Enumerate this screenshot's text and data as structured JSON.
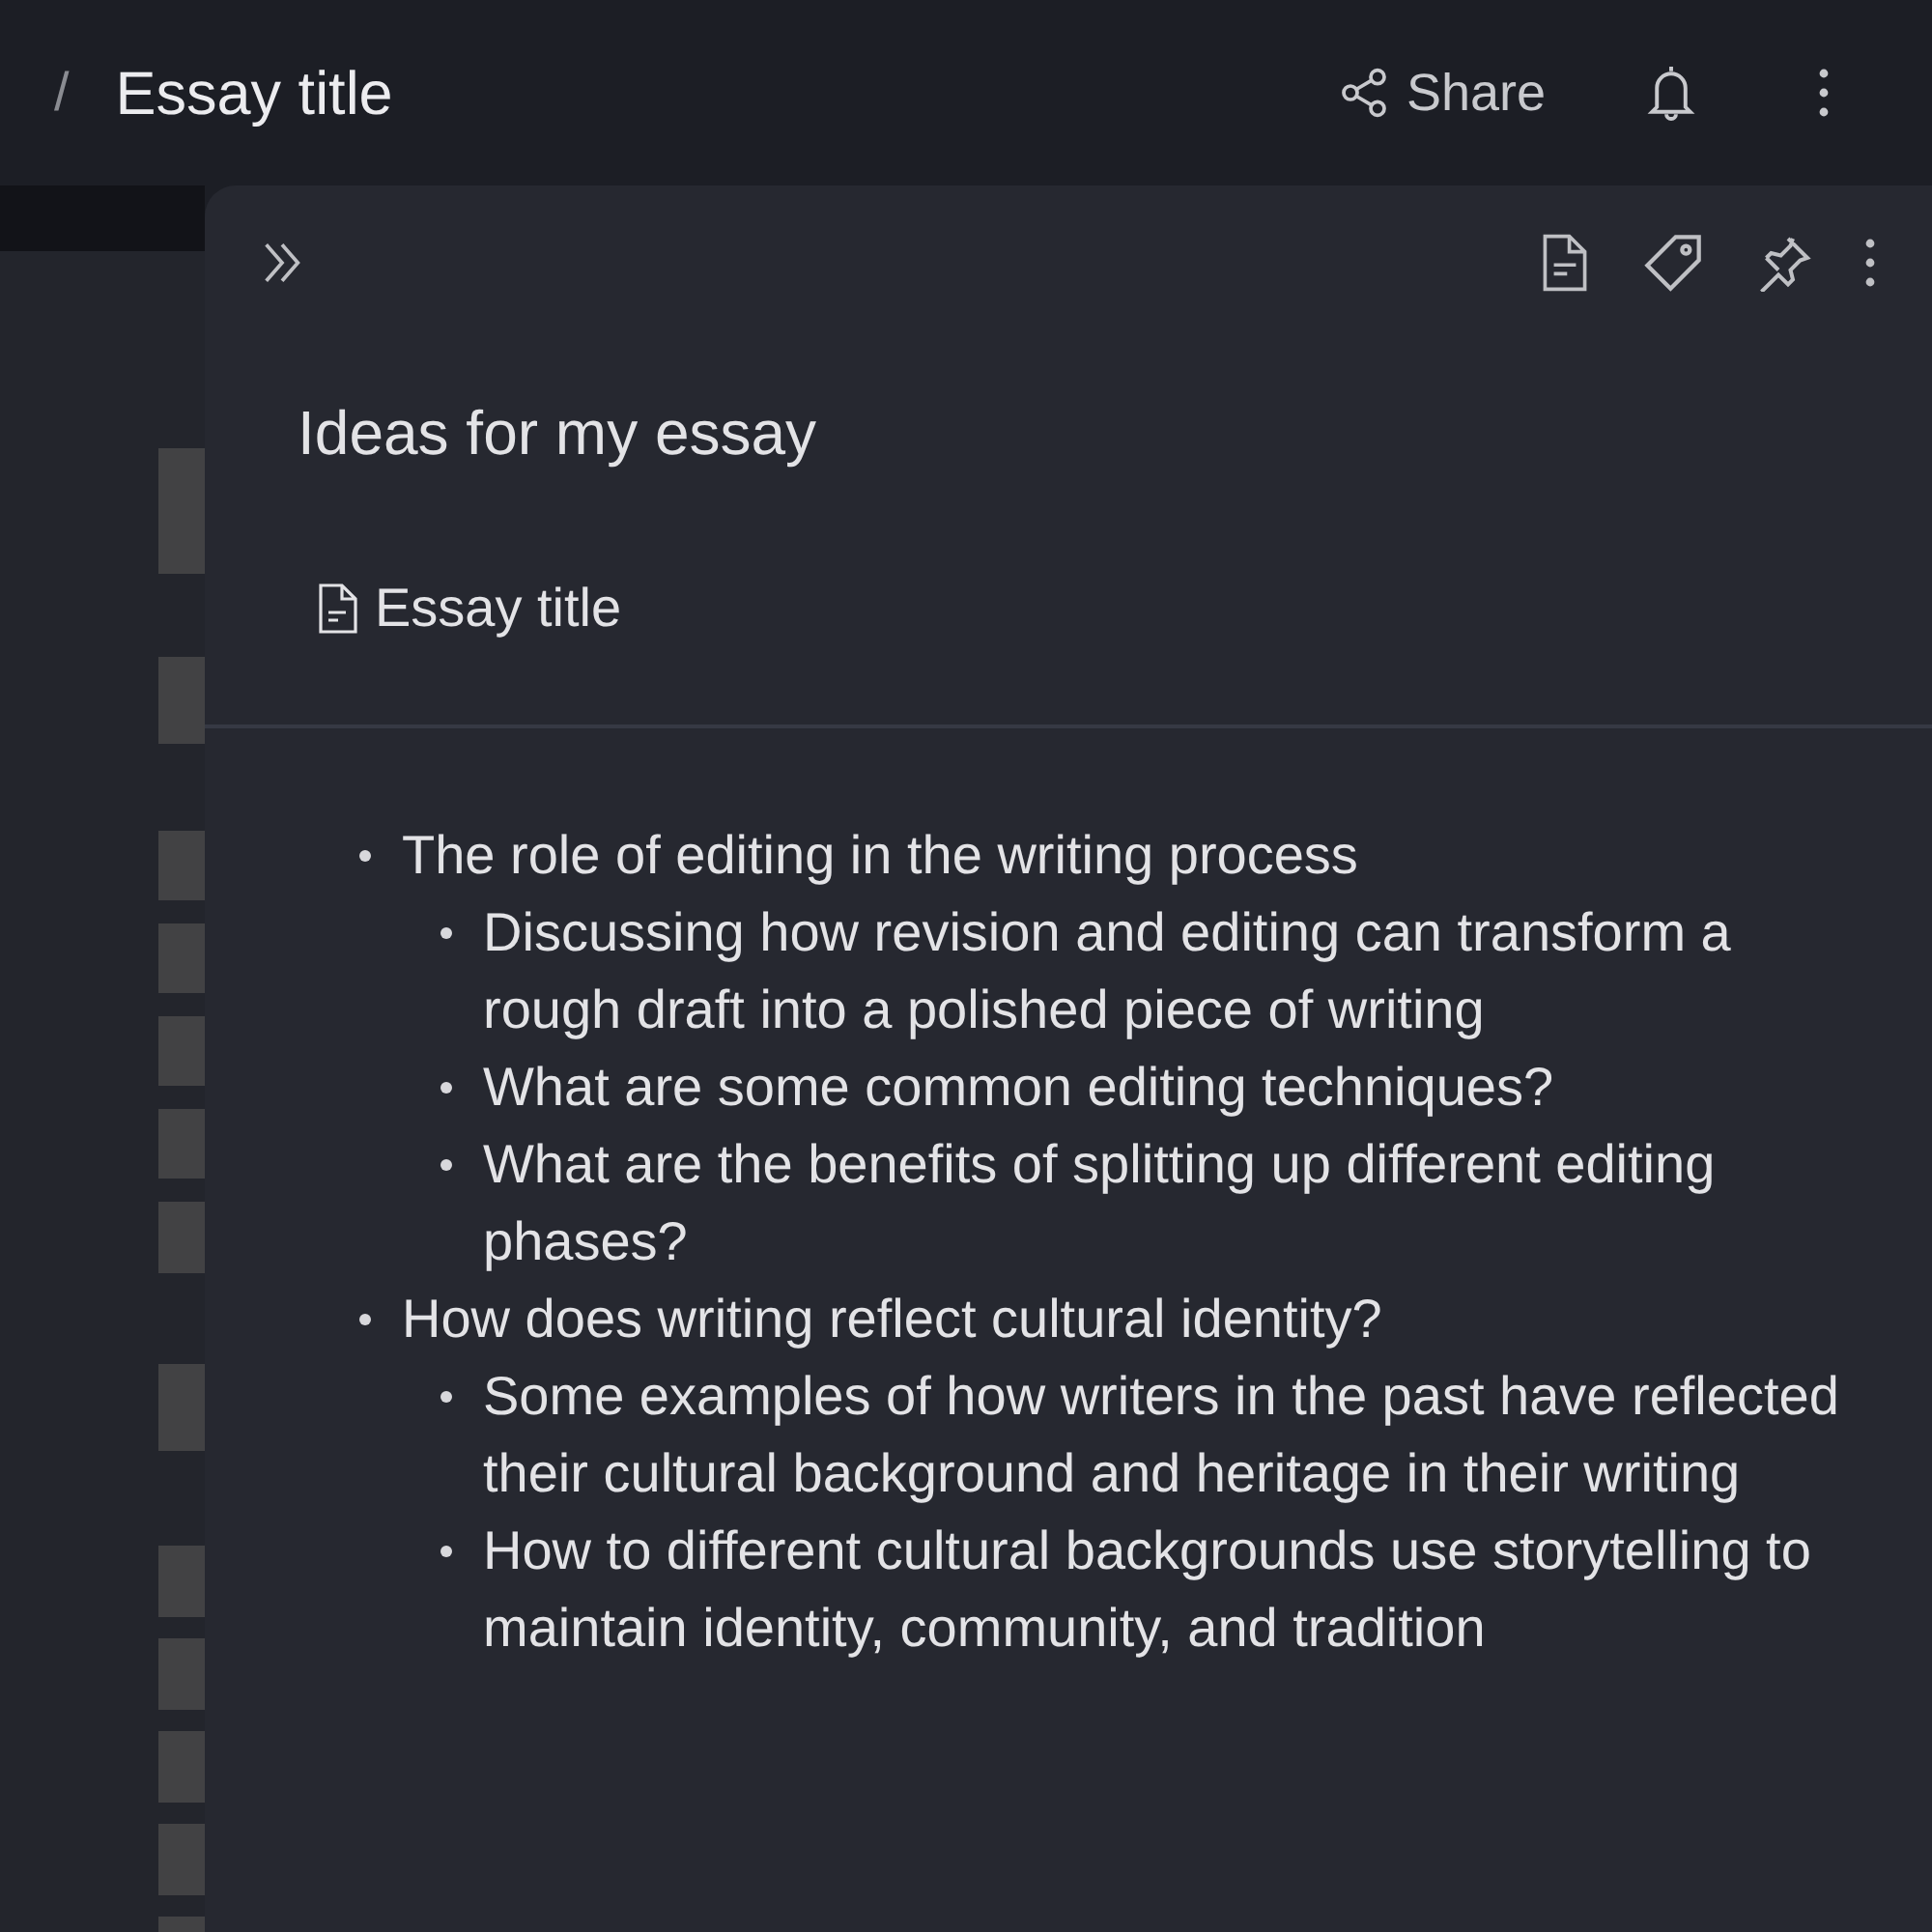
{
  "header": {
    "separator": "/",
    "title": "Essay title",
    "share_label": "Share"
  },
  "note": {
    "title": "Ideas for my essay",
    "linked_note": "Essay title",
    "outline": [
      {
        "text": "The role of editing in the writing process",
        "children": [
          {
            "text": "Discussing how revision and editing can transform a rough draft into a polished piece of writing"
          },
          {
            "text": "What are some common editing techniques?"
          },
          {
            "text": "What are the benefits of splitting up different editing phases?"
          }
        ]
      },
      {
        "text": "How does writing reflect cultural identity?",
        "children": [
          {
            "text": "Some examples of how writers in the past have reflected their cultural background and heritage in their writing"
          },
          {
            "text": "How to different cultural backgrounds use storytelling to maintain identity, community, and tradition"
          }
        ]
      }
    ]
  }
}
